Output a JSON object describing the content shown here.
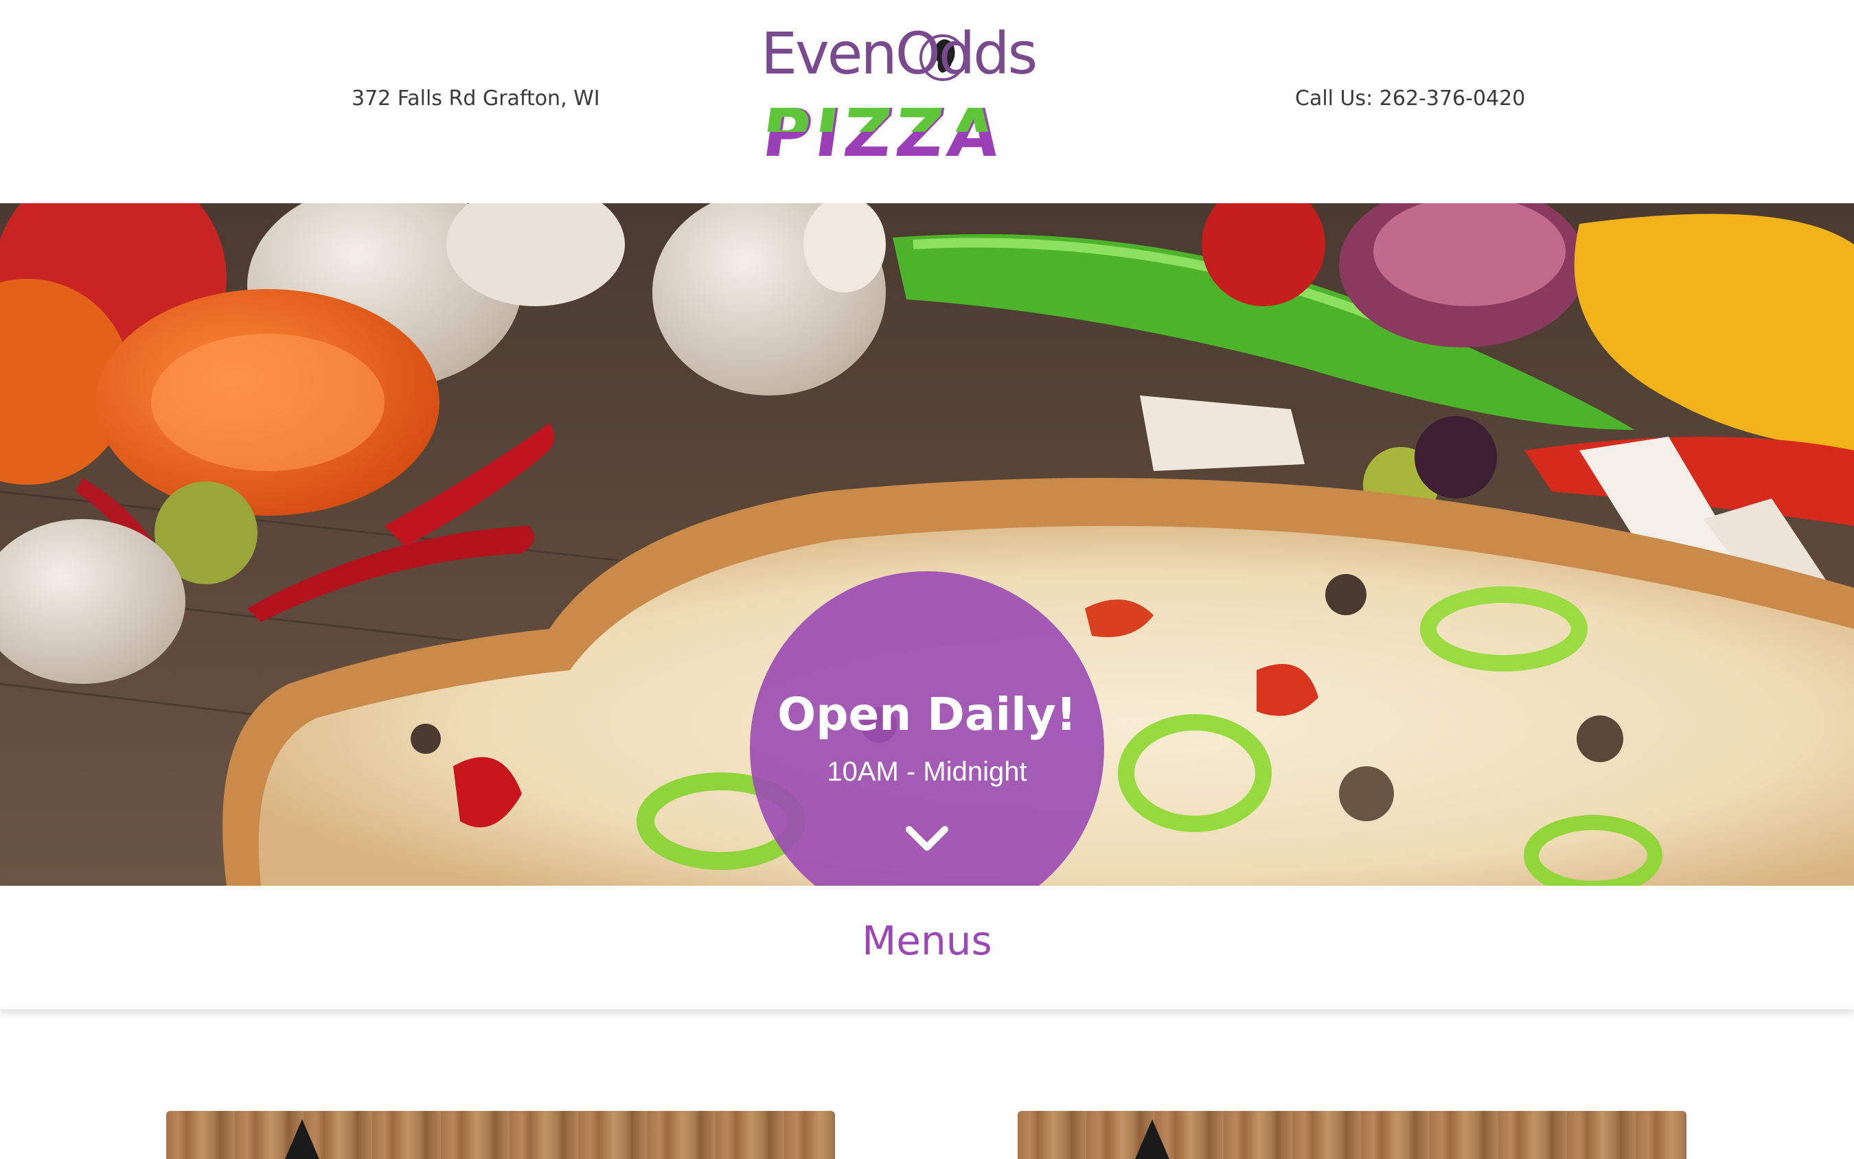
{
  "header": {
    "address": "372 Falls Rd Grafton, WI",
    "phone": "Call Us: 262-376-0420",
    "logo": {
      "line1": "EvenOdds",
      "line2": "PIZZA",
      "brand_purple": "#7a4a8f",
      "brand_green": "#5fc63a"
    }
  },
  "hero": {
    "title": "Open Daily!",
    "subtitle": "10AM - Midnight",
    "scroll_icon": "chevron-down-icon",
    "circle_color": "#9b4bb4"
  },
  "menus": {
    "title": "Menus",
    "accent": "#9b47b6"
  }
}
